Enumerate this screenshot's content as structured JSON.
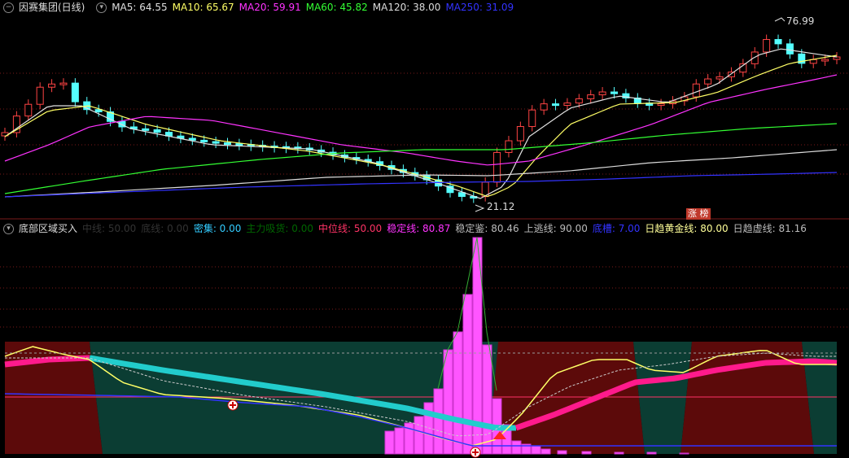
{
  "main": {
    "title": "因赛集团(日线)",
    "ma": [
      {
        "label": "MA5: 64.55",
        "color": "#e0e0e0"
      },
      {
        "label": "MA10: 65.67",
        "color": "#ffff66"
      },
      {
        "label": "MA20: 59.91",
        "color": "#ff33ff"
      },
      {
        "label": "MA60: 45.82",
        "color": "#33ff33"
      },
      {
        "label": "MA120: 38.00",
        "color": "#dcdcdc"
      },
      {
        "label": "MA250: 31.09",
        "color": "#3333ff"
      }
    ],
    "high_label": "76.99",
    "low_label": "21.12",
    "badge": "涨 榜"
  },
  "sub": {
    "title": "底部区域买入",
    "items": [
      {
        "label": "中线: 50.00",
        "color": "#333333"
      },
      {
        "label": "底线: 0.00",
        "color": "#333333"
      },
      {
        "label": "密集: 0.00",
        "color": "#33ccff"
      },
      {
        "label": "主力吸货: 0.00",
        "color": "#006600"
      },
      {
        "label": "中位线: 50.00",
        "color": "#ff3366"
      },
      {
        "label": "稳定线: 80.87",
        "color": "#ff33ff"
      },
      {
        "label": "稳定鉴: 80.46",
        "color": "#bbbbbb"
      },
      {
        "label": "上逃线: 90.00",
        "color": "#bbbbbb"
      },
      {
        "label": "底槽: 7.00",
        "color": "#3333ff"
      },
      {
        "label": "日趋黄金线: 80.00",
        "color": "#ffff99"
      },
      {
        "label": "日趋虚线: 81.16",
        "color": "#bbbbbb"
      }
    ]
  }
}
